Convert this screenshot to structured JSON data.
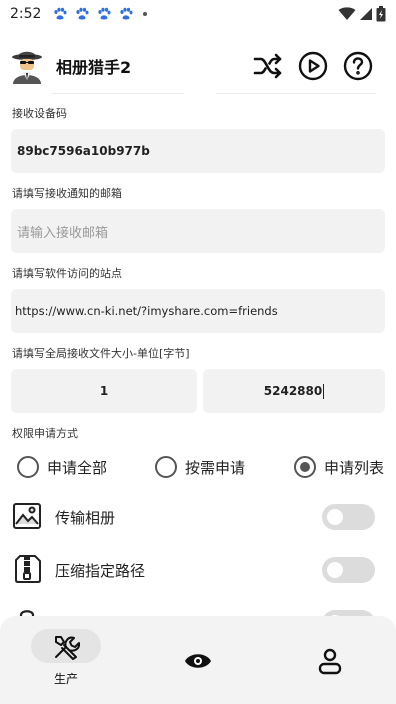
{
  "status_bar": {
    "time": "2:52"
  },
  "app": {
    "title": "相册猎手2"
  },
  "toolbar": {
    "shuffle_icon": "shuffle-icon",
    "play_icon": "play-circle-icon",
    "help_icon": "help-circle-icon"
  },
  "form": {
    "device_code_label": "接收设备码",
    "device_code_value": "89bc7596a10b977b",
    "email_label": "请填写接收通知的邮箱",
    "email_placeholder": "请输入接收邮箱",
    "site_label": "请填写软件访问的站点",
    "site_value": "https://www.cn-ki.net/?imyshare.com=friends",
    "size_label": "请填写全局接收文件大小-单位[字节]",
    "size_min": "1",
    "size_max": "5242880"
  },
  "permission": {
    "label": "权限申请方式",
    "options": [
      {
        "label": "申请全部",
        "selected": false
      },
      {
        "label": "按需申请",
        "selected": false
      },
      {
        "label": "申请列表",
        "selected": true
      }
    ]
  },
  "settings": [
    {
      "label": "传输相册",
      "icon": "image-icon",
      "enabled": false
    },
    {
      "label": "压缩指定路径",
      "icon": "compress-file-icon",
      "enabled": false
    },
    {
      "label": "",
      "icon": "lock-icon",
      "enabled": false
    }
  ],
  "bottom_nav": {
    "items": [
      {
        "label": "生产",
        "icon": "tools-icon",
        "active": true
      },
      {
        "label": "",
        "icon": "eye-icon",
        "active": false
      },
      {
        "label": "",
        "icon": "user-icon",
        "active": false
      }
    ]
  }
}
